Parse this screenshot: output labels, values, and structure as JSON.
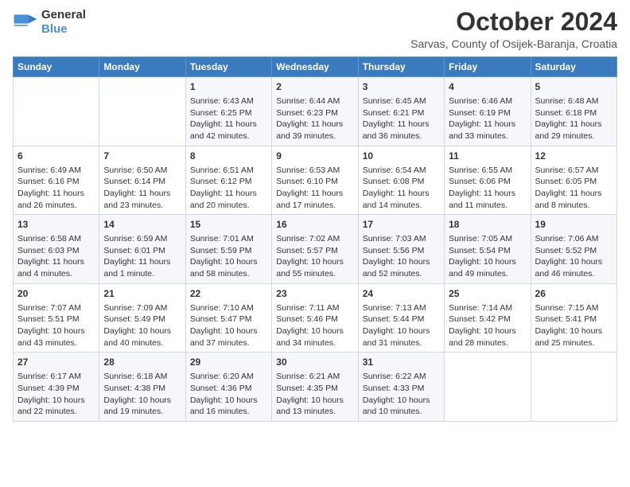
{
  "logo": {
    "line1": "General",
    "line2": "Blue"
  },
  "title": "October 2024",
  "subtitle": "Sarvas, County of Osijek-Baranja, Croatia",
  "headers": [
    "Sunday",
    "Monday",
    "Tuesday",
    "Wednesday",
    "Thursday",
    "Friday",
    "Saturday"
  ],
  "weeks": [
    [
      {
        "day": "",
        "sunrise": "",
        "sunset": "",
        "daylight": ""
      },
      {
        "day": "",
        "sunrise": "",
        "sunset": "",
        "daylight": ""
      },
      {
        "day": "1",
        "sunrise": "Sunrise: 6:43 AM",
        "sunset": "Sunset: 6:25 PM",
        "daylight": "Daylight: 11 hours and 42 minutes."
      },
      {
        "day": "2",
        "sunrise": "Sunrise: 6:44 AM",
        "sunset": "Sunset: 6:23 PM",
        "daylight": "Daylight: 11 hours and 39 minutes."
      },
      {
        "day": "3",
        "sunrise": "Sunrise: 6:45 AM",
        "sunset": "Sunset: 6:21 PM",
        "daylight": "Daylight: 11 hours and 36 minutes."
      },
      {
        "day": "4",
        "sunrise": "Sunrise: 6:46 AM",
        "sunset": "Sunset: 6:19 PM",
        "daylight": "Daylight: 11 hours and 33 minutes."
      },
      {
        "day": "5",
        "sunrise": "Sunrise: 6:48 AM",
        "sunset": "Sunset: 6:18 PM",
        "daylight": "Daylight: 11 hours and 29 minutes."
      }
    ],
    [
      {
        "day": "6",
        "sunrise": "Sunrise: 6:49 AM",
        "sunset": "Sunset: 6:16 PM",
        "daylight": "Daylight: 11 hours and 26 minutes."
      },
      {
        "day": "7",
        "sunrise": "Sunrise: 6:50 AM",
        "sunset": "Sunset: 6:14 PM",
        "daylight": "Daylight: 11 hours and 23 minutes."
      },
      {
        "day": "8",
        "sunrise": "Sunrise: 6:51 AM",
        "sunset": "Sunset: 6:12 PM",
        "daylight": "Daylight: 11 hours and 20 minutes."
      },
      {
        "day": "9",
        "sunrise": "Sunrise: 6:53 AM",
        "sunset": "Sunset: 6:10 PM",
        "daylight": "Daylight: 11 hours and 17 minutes."
      },
      {
        "day": "10",
        "sunrise": "Sunrise: 6:54 AM",
        "sunset": "Sunset: 6:08 PM",
        "daylight": "Daylight: 11 hours and 14 minutes."
      },
      {
        "day": "11",
        "sunrise": "Sunrise: 6:55 AM",
        "sunset": "Sunset: 6:06 PM",
        "daylight": "Daylight: 11 hours and 11 minutes."
      },
      {
        "day": "12",
        "sunrise": "Sunrise: 6:57 AM",
        "sunset": "Sunset: 6:05 PM",
        "daylight": "Daylight: 11 hours and 8 minutes."
      }
    ],
    [
      {
        "day": "13",
        "sunrise": "Sunrise: 6:58 AM",
        "sunset": "Sunset: 6:03 PM",
        "daylight": "Daylight: 11 hours and 4 minutes."
      },
      {
        "day": "14",
        "sunrise": "Sunrise: 6:59 AM",
        "sunset": "Sunset: 6:01 PM",
        "daylight": "Daylight: 11 hours and 1 minute."
      },
      {
        "day": "15",
        "sunrise": "Sunrise: 7:01 AM",
        "sunset": "Sunset: 5:59 PM",
        "daylight": "Daylight: 10 hours and 58 minutes."
      },
      {
        "day": "16",
        "sunrise": "Sunrise: 7:02 AM",
        "sunset": "Sunset: 5:57 PM",
        "daylight": "Daylight: 10 hours and 55 minutes."
      },
      {
        "day": "17",
        "sunrise": "Sunrise: 7:03 AM",
        "sunset": "Sunset: 5:56 PM",
        "daylight": "Daylight: 10 hours and 52 minutes."
      },
      {
        "day": "18",
        "sunrise": "Sunrise: 7:05 AM",
        "sunset": "Sunset: 5:54 PM",
        "daylight": "Daylight: 10 hours and 49 minutes."
      },
      {
        "day": "19",
        "sunrise": "Sunrise: 7:06 AM",
        "sunset": "Sunset: 5:52 PM",
        "daylight": "Daylight: 10 hours and 46 minutes."
      }
    ],
    [
      {
        "day": "20",
        "sunrise": "Sunrise: 7:07 AM",
        "sunset": "Sunset: 5:51 PM",
        "daylight": "Daylight: 10 hours and 43 minutes."
      },
      {
        "day": "21",
        "sunrise": "Sunrise: 7:09 AM",
        "sunset": "Sunset: 5:49 PM",
        "daylight": "Daylight: 10 hours and 40 minutes."
      },
      {
        "day": "22",
        "sunrise": "Sunrise: 7:10 AM",
        "sunset": "Sunset: 5:47 PM",
        "daylight": "Daylight: 10 hours and 37 minutes."
      },
      {
        "day": "23",
        "sunrise": "Sunrise: 7:11 AM",
        "sunset": "Sunset: 5:46 PM",
        "daylight": "Daylight: 10 hours and 34 minutes."
      },
      {
        "day": "24",
        "sunrise": "Sunrise: 7:13 AM",
        "sunset": "Sunset: 5:44 PM",
        "daylight": "Daylight: 10 hours and 31 minutes."
      },
      {
        "day": "25",
        "sunrise": "Sunrise: 7:14 AM",
        "sunset": "Sunset: 5:42 PM",
        "daylight": "Daylight: 10 hours and 28 minutes."
      },
      {
        "day": "26",
        "sunrise": "Sunrise: 7:15 AM",
        "sunset": "Sunset: 5:41 PM",
        "daylight": "Daylight: 10 hours and 25 minutes."
      }
    ],
    [
      {
        "day": "27",
        "sunrise": "Sunrise: 6:17 AM",
        "sunset": "Sunset: 4:39 PM",
        "daylight": "Daylight: 10 hours and 22 minutes."
      },
      {
        "day": "28",
        "sunrise": "Sunrise: 6:18 AM",
        "sunset": "Sunset: 4:38 PM",
        "daylight": "Daylight: 10 hours and 19 minutes."
      },
      {
        "day": "29",
        "sunrise": "Sunrise: 6:20 AM",
        "sunset": "Sunset: 4:36 PM",
        "daylight": "Daylight: 10 hours and 16 minutes."
      },
      {
        "day": "30",
        "sunrise": "Sunrise: 6:21 AM",
        "sunset": "Sunset: 4:35 PM",
        "daylight": "Daylight: 10 hours and 13 minutes."
      },
      {
        "day": "31",
        "sunrise": "Sunrise: 6:22 AM",
        "sunset": "Sunset: 4:33 PM",
        "daylight": "Daylight: 10 hours and 10 minutes."
      },
      {
        "day": "",
        "sunrise": "",
        "sunset": "",
        "daylight": ""
      },
      {
        "day": "",
        "sunrise": "",
        "sunset": "",
        "daylight": ""
      }
    ]
  ]
}
